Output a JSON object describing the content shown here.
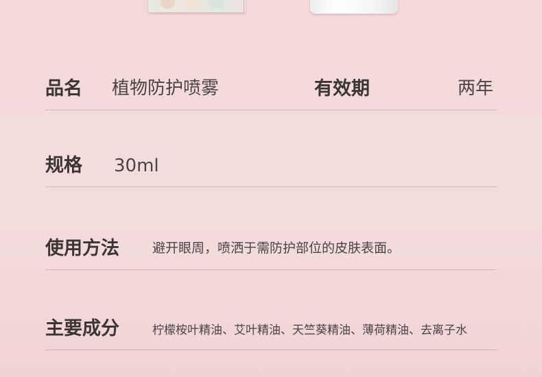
{
  "rows": {
    "name": {
      "label": "品名",
      "value": "植物防护喷雾"
    },
    "validity": {
      "label": "有效期",
      "value": "两年"
    },
    "spec": {
      "label": "规格",
      "value": "30ml"
    },
    "usage": {
      "label": "使用方法",
      "value": "避开眼周，喷洒于需防护部位的皮肤表面。"
    },
    "ingredients": {
      "label": "主要成分",
      "value": "柠檬桉叶精油、艾叶精油、天竺葵精油、薄荷精油、去离子水"
    }
  }
}
